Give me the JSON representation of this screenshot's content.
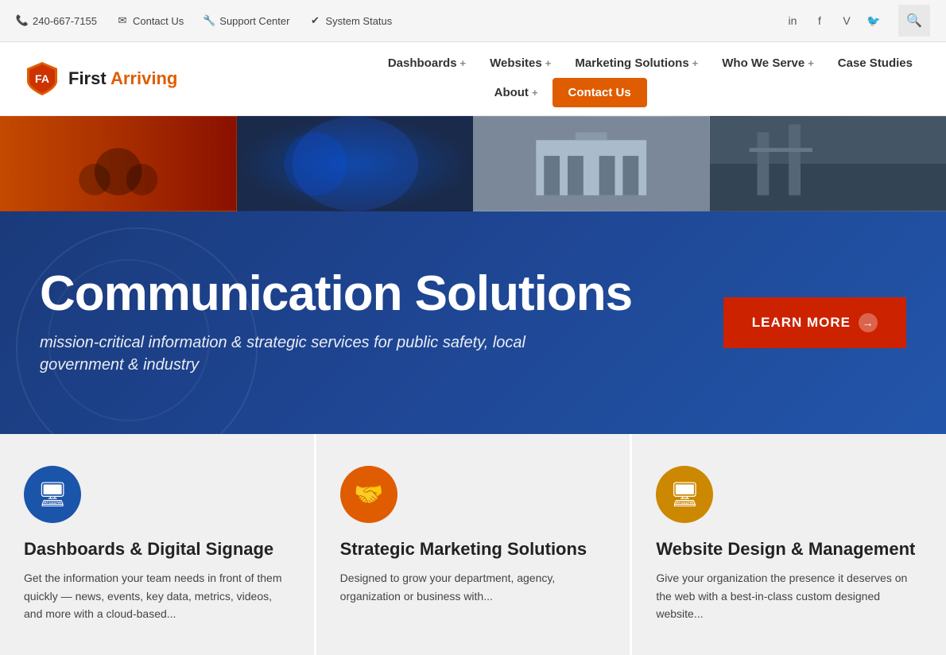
{
  "topbar": {
    "phone": "240-667-7155",
    "contact": "Contact Us",
    "support": "Support Center",
    "status": "System Status",
    "phone_icon": "📞",
    "mail_icon": "✉",
    "support_icon": "🔧",
    "check_icon": "✔"
  },
  "logo": {
    "text_first": "First",
    "text_second": " Arriving"
  },
  "nav": {
    "items_top": [
      {
        "label": "Dashboards",
        "has_plus": true
      },
      {
        "label": "Websites",
        "has_plus": true
      },
      {
        "label": "Marketing Solutions",
        "has_plus": true
      },
      {
        "label": "Who We Serve",
        "has_plus": true
      },
      {
        "label": "Case Studies",
        "has_plus": false
      }
    ],
    "items_bottom": [
      {
        "label": "About",
        "has_plus": true
      },
      {
        "label": "Contact Us",
        "is_cta": true
      }
    ]
  },
  "hero": {
    "title": "Communication Solutions",
    "subtitle": "mission-critical information & strategic services for public safety, local government & industry",
    "cta_label": "LEARN MORE"
  },
  "services": [
    {
      "icon": "🖥",
      "icon_color": "blue",
      "title": "Dashboards & Digital Signage",
      "desc": "Get the information your team needs in front of them quickly — news, events, key data, metrics, videos, and more with a cloud-based..."
    },
    {
      "icon": "🤝",
      "icon_color": "orange",
      "title": "Strategic Marketing Solutions",
      "desc": "Designed to grow your department, agency, organization or business with..."
    },
    {
      "icon": "🖥",
      "icon_color": "amber",
      "title": "Website Design & Management",
      "desc": "Give your organization the presence it deserves on the web with a best-in-class custom designed website..."
    }
  ]
}
